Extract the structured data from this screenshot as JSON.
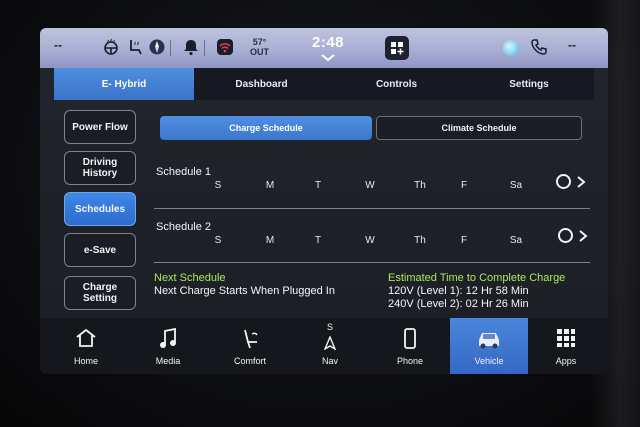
{
  "status_bar": {
    "left_text": "--",
    "temperature": "57°",
    "temperature_label": "OUT",
    "time": "2:48",
    "icons": [
      "steering-heat-icon",
      "seat-heat-icon",
      "compass-icon",
      "bell-icon",
      "wifi-icon",
      "apps-grid-icon",
      "status-orb-icon",
      "phone-icon"
    ],
    "right_text": "--"
  },
  "tabs": [
    {
      "label": "E- Hybrid",
      "active": true
    },
    {
      "label": "Dashboard",
      "active": false
    },
    {
      "label": "Controls",
      "active": false
    },
    {
      "label": "Settings",
      "active": false
    }
  ],
  "sidebar": [
    {
      "label": "Power Flow",
      "active": false
    },
    {
      "label": "Driving History",
      "active": false
    },
    {
      "label": "Schedules",
      "active": true
    },
    {
      "label": "e-Save",
      "active": false
    },
    {
      "label": "Charge Setting",
      "active": false
    }
  ],
  "subtabs": {
    "charge": "Charge Schedule",
    "climate": "Climate Schedule"
  },
  "schedules": [
    {
      "title": "Schedule 1",
      "days": [
        "S",
        "M",
        "T",
        "W",
        "Th",
        "F",
        "Sa"
      ],
      "enabled": false
    },
    {
      "title": "Schedule 2",
      "days": [
        "S",
        "M",
        "T",
        "W",
        "Th",
        "F",
        "Sa"
      ],
      "enabled": false
    }
  ],
  "next_schedule": {
    "title": "Next Schedule",
    "text": "Next Charge Starts When Plugged In"
  },
  "estimate": {
    "title": "Estimated Time to Complete Charge",
    "level1": "120V (Level 1): 12 Hr 58 Min",
    "level2": "240V (Level 2): 02 Hr 26 Min"
  },
  "nav": [
    {
      "label": "Home",
      "icon": "home-icon",
      "active": false
    },
    {
      "label": "Media",
      "icon": "music-note-icon",
      "active": false
    },
    {
      "label": "Comfort",
      "icon": "seat-icon",
      "active": false
    },
    {
      "label": "Nav",
      "icon": "compass-arrow-icon",
      "compass_letter": "S",
      "active": false
    },
    {
      "label": "Phone",
      "icon": "phone-device-icon",
      "active": false
    },
    {
      "label": "Vehicle",
      "icon": "car-icon",
      "active": true
    },
    {
      "label": "Apps",
      "icon": "apps-grid-icon",
      "active": false
    }
  ],
  "colors": {
    "accent_blue": "#3f7ed8",
    "status_green": "#a9e85a",
    "status_bar": "#a9afd3"
  }
}
